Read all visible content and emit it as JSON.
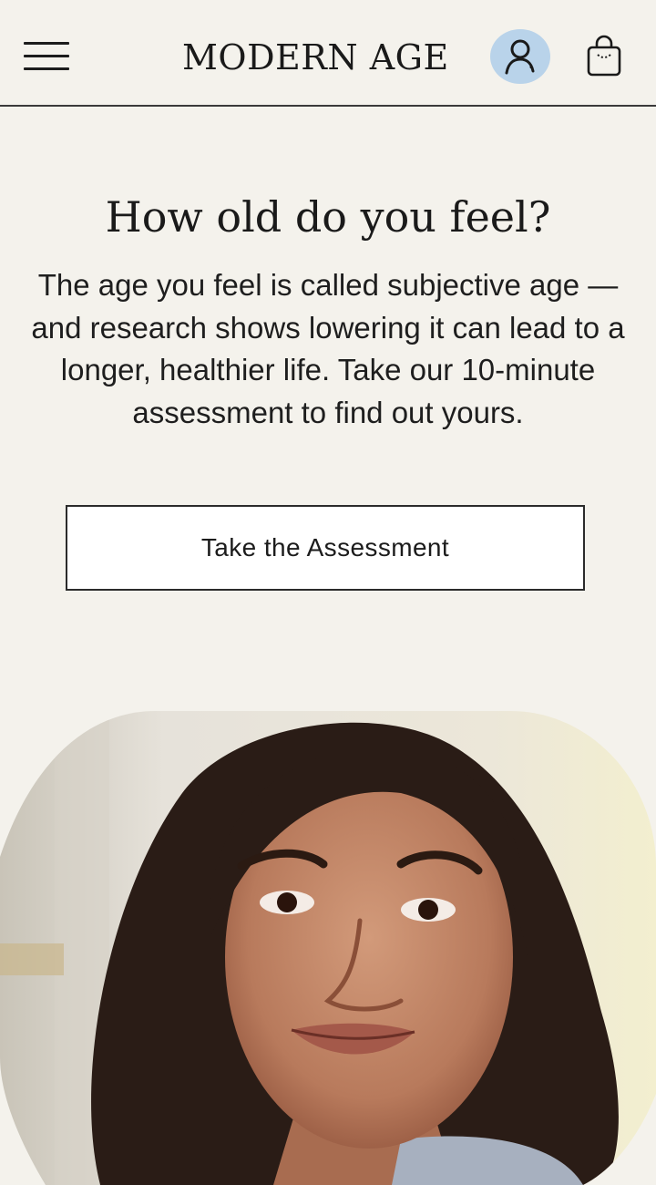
{
  "header": {
    "brand": "MODERN AGE",
    "menu_icon": "hamburger-menu-icon",
    "account_icon": "user-account-icon",
    "cart_icon": "shopping-bag-icon",
    "account_badge_color": "#b9d3ea"
  },
  "hero": {
    "headline": "How old do you feel?",
    "body": "The age you feel is called subjective age — and research shows lowering it can lead to a longer, healthier life. Take our 10-minute assessment to find out yours.",
    "cta_label": "Take the Assessment"
  },
  "theme": {
    "background": "#f4f2ec",
    "text": "#1c1c1c"
  }
}
